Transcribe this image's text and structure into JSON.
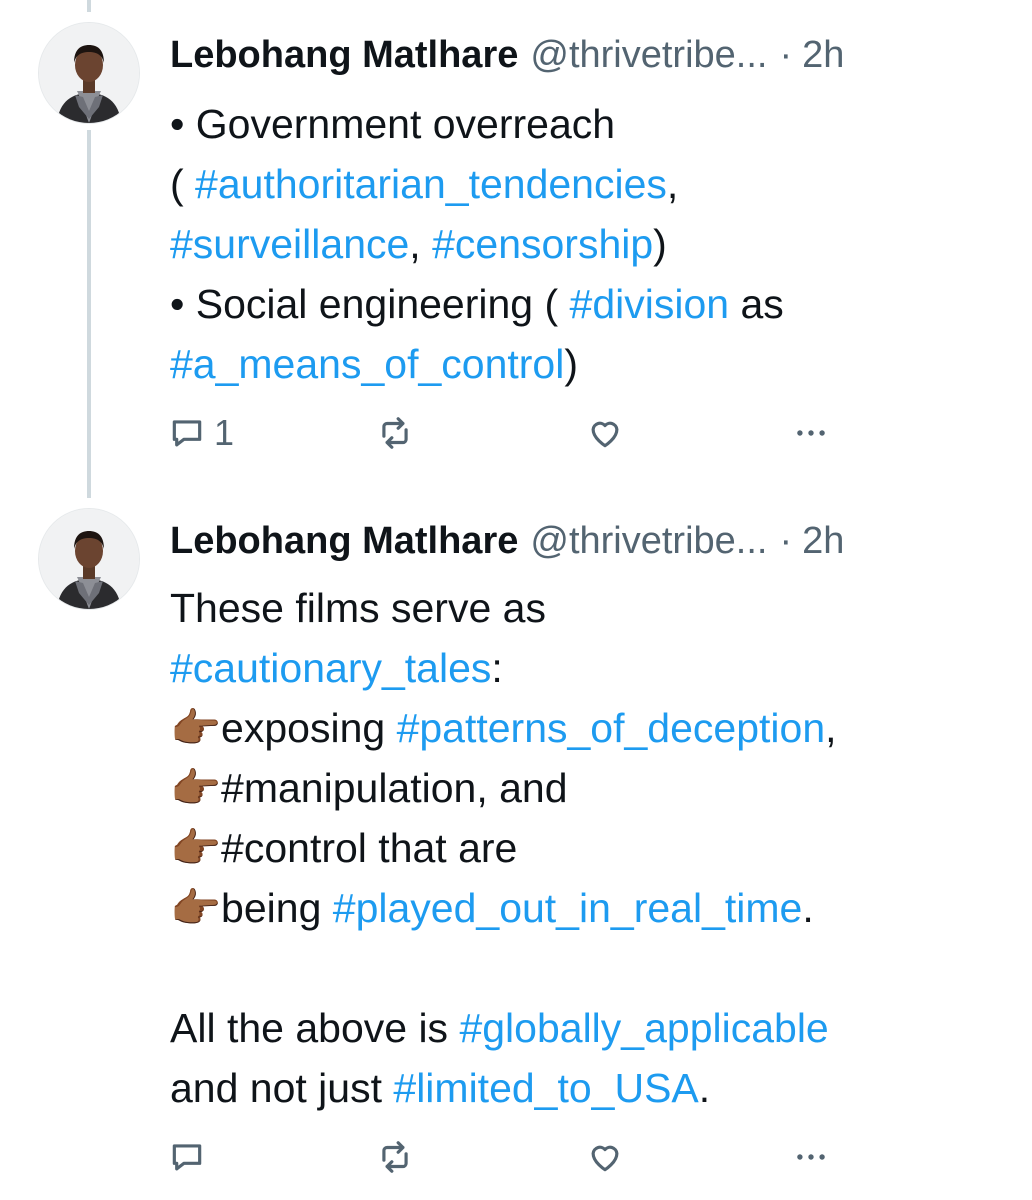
{
  "tweets": [
    {
      "author": {
        "name": "Lebohang Matlhare",
        "handle": "@thrivetribe...",
        "separator": "·",
        "time": "2h"
      },
      "lines": [
        [
          {
            "t": "• Government overreach"
          }
        ],
        [
          {
            "t": "( "
          },
          {
            "t": "#authoritarian_tendencies",
            "tag": true
          },
          {
            "t": ","
          }
        ],
        [
          {
            "t": "#surveillance",
            "tag": true
          },
          {
            "t": ", "
          },
          {
            "t": "#censorship",
            "tag": true
          },
          {
            "t": ")"
          }
        ],
        [
          {
            "t": "• Social engineering ( "
          },
          {
            "t": "#division",
            "tag": true
          },
          {
            "t": " as"
          }
        ],
        [
          {
            "t": "#a_means_of_control",
            "tag": true
          },
          {
            "t": ")"
          }
        ]
      ],
      "actions": {
        "reply_count": "1",
        "retweet_count": "",
        "like_count": ""
      }
    },
    {
      "author": {
        "name": "Lebohang Matlhare",
        "handle": "@thrivetribe...",
        "separator": "·",
        "time": "2h"
      },
      "lines": [
        [
          {
            "t": "These films serve as"
          }
        ],
        [
          {
            "t": "#cautionary_tales",
            "tag": true
          },
          {
            "t": ":"
          }
        ],
        [
          {
            "t": "👉🏾exposing "
          },
          {
            "t": "#patterns_of_deception",
            "tag": true
          },
          {
            "t": ","
          }
        ],
        [
          {
            "t": "👉🏾#manipulation, and"
          }
        ],
        [
          {
            "t": "👉🏾#control that are"
          }
        ],
        [
          {
            "t": "👉🏾being "
          },
          {
            "t": "#played_out_in_real_time",
            "tag": true
          },
          {
            "t": "."
          }
        ],
        [
          {
            "t": " "
          }
        ],
        [
          {
            "t": "All the above is "
          },
          {
            "t": "#globally_applicable",
            "tag": true
          }
        ],
        [
          {
            "t": "and not just "
          },
          {
            "t": "#limited_to_USA",
            "tag": true
          },
          {
            "t": "."
          }
        ]
      ],
      "actions": {
        "reply_count": "",
        "retweet_count": "",
        "like_count": ""
      }
    }
  ],
  "icons": {
    "reply": "reply-icon",
    "retweet": "retweet-icon",
    "like": "heart-icon",
    "more": "more-icon"
  },
  "colors": {
    "text": "#0f1419",
    "secondary": "#536471",
    "hashtag": "#1d9bf0",
    "thread_line": "#cfd9de"
  }
}
